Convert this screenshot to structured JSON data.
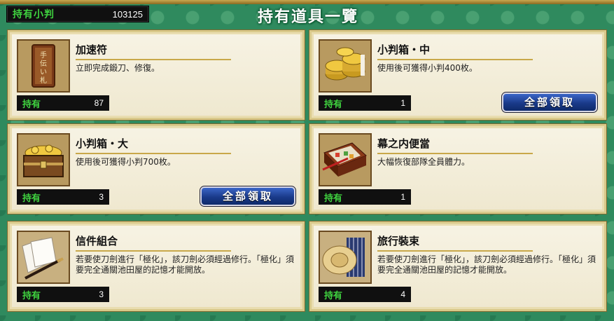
{
  "header": {
    "coins_label": "持有小判",
    "coins_value": "103125",
    "title": "持有道具一覽"
  },
  "owned_label": "持有",
  "claim_label": "全部領取",
  "items": [
    {
      "name": "加速符",
      "desc": "立即完成鍛刀、修復。",
      "count": "87",
      "icon": "token-icon"
    },
    {
      "name": "小判箱・中",
      "desc": "使用後可獲得小判400枚。",
      "count": "1",
      "icon": "coin-stack-icon"
    },
    {
      "name": "小判箱・大",
      "desc": "使用後可獲得小判700枚。",
      "count": "3",
      "icon": "treasure-chest-icon"
    },
    {
      "name": "幕之内便當",
      "desc": "大幅恢復部隊全員體力。",
      "count": "1",
      "icon": "bento-box-icon"
    },
    {
      "name": "信件組合",
      "desc": "若要使刀劍進行「極化」，該刀劍必須經過修行。「極化」須要完全通關池田屋的記憶才能開放。",
      "count": "3",
      "icon": "letter-set-icon"
    },
    {
      "name": "旅行裝束",
      "desc": "若要使刀劍進行「極化」，該刀劍必須經過修行。「極化」須要完全通關池田屋的記憶才能開放。",
      "count": "4",
      "icon": "travel-gear-icon"
    }
  ]
}
